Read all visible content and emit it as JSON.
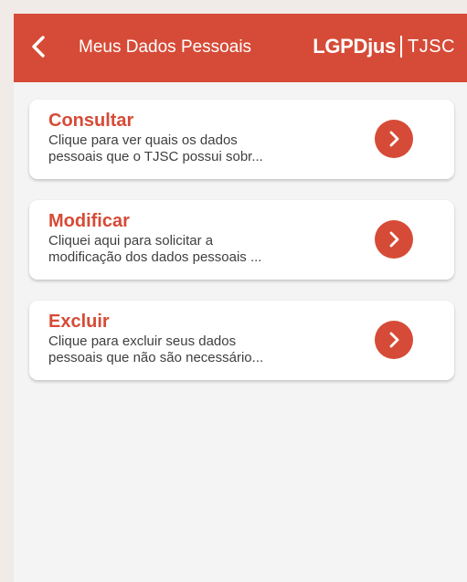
{
  "header": {
    "title": "Meus Dados Pessoais",
    "brand_bold": "LGPDjus",
    "brand_light": "TJSC",
    "back_icon": "chevron-left-icon"
  },
  "colors": {
    "accent": "#d64b37",
    "background": "#f5f4f4",
    "card": "#ffffff",
    "text": "#3f3f3f"
  },
  "cards": [
    {
      "title": "Consultar",
      "line1": "Clique para ver quais os dados",
      "line2": "pessoais que o TJSC possui sobr...",
      "icon": "chevron-right-icon"
    },
    {
      "title": "Modificar",
      "line1": "Cliquei aqui para solicitar a",
      "line2": "modificação dos dados pessoais ...",
      "icon": "chevron-right-icon"
    },
    {
      "title": "Excluir",
      "line1": "Clique para excluir seus dados",
      "line2": "pessoais que não são necessário...",
      "icon": "chevron-right-icon"
    }
  ]
}
